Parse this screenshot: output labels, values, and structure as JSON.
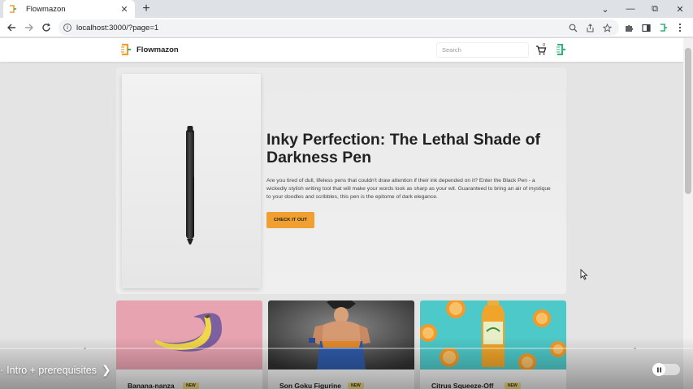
{
  "browser": {
    "tab_title": "Flowmazon",
    "tab_close": "✕",
    "new_tab": "+",
    "url": "localhost:3000/?page=1",
    "win_chevron": "⌄",
    "win_minimize": "—",
    "win_restore": "⧉",
    "win_close": "✕"
  },
  "site": {
    "brand": "Flowmazon",
    "search_placeholder": "Search",
    "cart_count": "0"
  },
  "hero": {
    "title": "Inky Perfection: The Lethal Shade of Darkness Pen",
    "description": "Are you tired of dull, lifeless pens that couldn't draw attention if their ink depended on it? Enter the Black Pen - a wickedly stylish writing tool that will make your words look as sharp as your wit. Guaranteed to bring an air of mystique to your doodles and scribbles, this pen is the epitome of dark elegance.",
    "cta": "CHECK IT OUT"
  },
  "products": [
    {
      "name": "Banana-nanza",
      "badge": "NEW"
    },
    {
      "name": "Son Goku Figurine",
      "badge": "NEW"
    },
    {
      "name": "Citrus Squeeze-Off",
      "badge": "NEW"
    }
  ],
  "video": {
    "chapter": "Intro + prerequisites",
    "chapter_prefix": "·",
    "chevron": "❯"
  },
  "colors": {
    "brand_orange": "#f0a030",
    "brand_green": "#2bb673",
    "badge": "#f5e38a"
  }
}
